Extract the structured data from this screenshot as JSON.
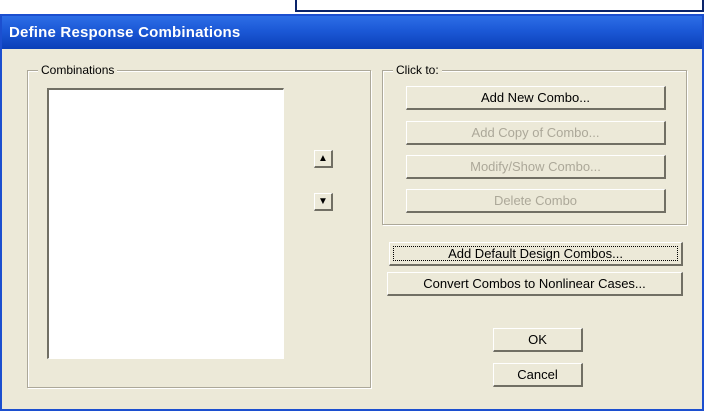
{
  "window": {
    "title": "Define Response Combinations"
  },
  "combinations_group": {
    "label": "Combinations",
    "items": []
  },
  "move_buttons": {
    "up_icon": "arrow-up-icon",
    "down_icon": "arrow-down-icon"
  },
  "click_to_group": {
    "label": "Click to:",
    "add_new": "Add New Combo...",
    "add_copy": "Add Copy of Combo...",
    "modify_show": "Modify/Show Combo...",
    "delete": "Delete Combo"
  },
  "actions": {
    "add_default": "Add Default Design Combos...",
    "convert": "Convert Combos to Nonlinear Cases..."
  },
  "footer": {
    "ok": "OK",
    "cancel": "Cancel"
  },
  "colors": {
    "titlebar": "#1b58d6",
    "dialog_bg": "#ece9d8",
    "disabled_text": "#aca899"
  }
}
